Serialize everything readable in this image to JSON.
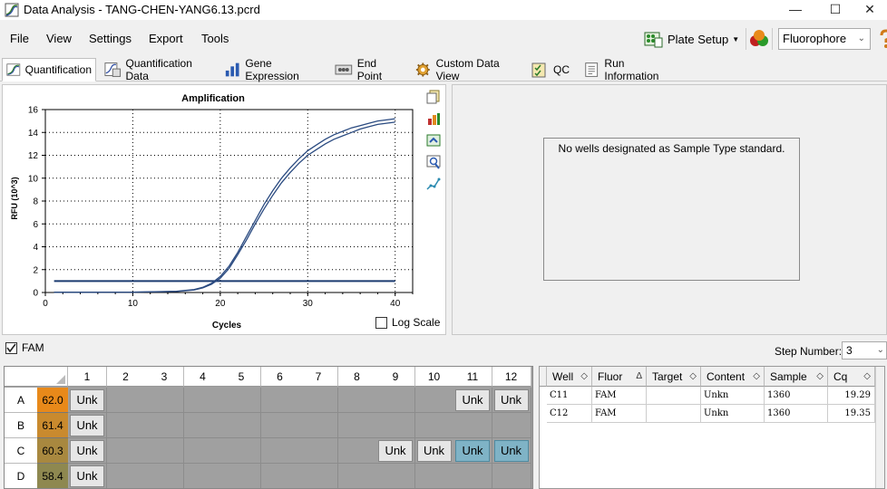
{
  "window": {
    "title": "Data Analysis - TANG-CHEN-YANG6.13.pcrd"
  },
  "menu": [
    "File",
    "View",
    "Settings",
    "Export",
    "Tools"
  ],
  "toolbar": {
    "plate_setup": "Plate Setup",
    "fluorophore": "Fluorophore"
  },
  "tabs": [
    {
      "label": "Quantification",
      "active": true
    },
    {
      "label": "Quantification Data"
    },
    {
      "label": "Gene Expression"
    },
    {
      "label": "End Point"
    },
    {
      "label": "Custom Data View"
    },
    {
      "label": "QC"
    },
    {
      "label": "Run Information"
    }
  ],
  "chart_data": {
    "type": "line",
    "title": "Amplification",
    "xlabel": "Cycles",
    "ylabel": "RFU (10^3)",
    "xlim": [
      0,
      42
    ],
    "ylim": [
      0,
      16
    ],
    "xticks": [
      0,
      10,
      20,
      30,
      40
    ],
    "yticks": [
      0,
      2,
      4,
      6,
      8,
      10,
      12,
      14,
      16
    ],
    "grid": true,
    "threshold": 1.0,
    "threshold_x": [
      1,
      40
    ],
    "series": [
      {
        "well": "C11",
        "x": [
          1,
          5,
          10,
          15,
          17,
          18,
          19,
          20,
          21,
          22,
          23,
          24,
          25,
          26,
          27,
          28,
          29,
          30,
          31,
          32,
          33,
          34,
          35,
          36,
          37,
          38,
          39,
          40
        ],
        "y": [
          0.02,
          0.02,
          0.03,
          0.1,
          0.25,
          0.45,
          0.8,
          1.4,
          2.3,
          3.5,
          4.9,
          6.3,
          7.7,
          8.9,
          10.0,
          10.9,
          11.7,
          12.4,
          12.9,
          13.4,
          13.8,
          14.1,
          14.4,
          14.6,
          14.8,
          15.0,
          15.1,
          15.2
        ]
      },
      {
        "well": "C12",
        "x": [
          1,
          5,
          10,
          15,
          17,
          18,
          19,
          20,
          21,
          22,
          23,
          24,
          25,
          26,
          27,
          28,
          29,
          30,
          31,
          32,
          33,
          34,
          35,
          36,
          37,
          38,
          39,
          40
        ],
        "y": [
          0.02,
          0.02,
          0.03,
          0.09,
          0.22,
          0.4,
          0.72,
          1.25,
          2.1,
          3.3,
          4.6,
          6.0,
          7.3,
          8.5,
          9.6,
          10.5,
          11.3,
          12.0,
          12.5,
          13.0,
          13.4,
          13.7,
          14.0,
          14.3,
          14.5,
          14.7,
          14.8,
          14.9
        ]
      }
    ]
  },
  "chart_ui": {
    "log_scale_label": "Log Scale"
  },
  "std_box": {
    "message": "No wells designated as Sample Type standard."
  },
  "fam": {
    "label": "FAM",
    "step_label": "Step Number:",
    "step_value": "3"
  },
  "plate": {
    "columns": [
      "1",
      "2",
      "3",
      "4",
      "5",
      "6",
      "7",
      "8",
      "9",
      "10",
      "11",
      "12"
    ],
    "rows": [
      {
        "label": "A",
        "temp": "62.0",
        "temp_color": "#e8891a",
        "unk_cols": [
          1,
          11,
          12
        ],
        "sel_cols": []
      },
      {
        "label": "B",
        "temp": "61.4",
        "temp_color": "#c98a2e",
        "unk_cols": [
          1
        ],
        "sel_cols": []
      },
      {
        "label": "C",
        "temp": "60.3",
        "temp_color": "#a8883f",
        "unk_cols": [
          1,
          9,
          10,
          11,
          12
        ],
        "sel_cols": [
          11,
          12
        ]
      },
      {
        "label": "D",
        "temp": "58.4",
        "temp_color": "#8e8850",
        "unk_cols": [
          1
        ],
        "sel_cols": []
      }
    ],
    "unk_label": "Unk"
  },
  "well_table": {
    "headers": [
      "Well",
      "Fluor",
      "Target",
      "Content",
      "Sample",
      "Cq"
    ],
    "rows": [
      [
        "C11",
        "FAM",
        "",
        "Unkn",
        "1360",
        "19.29"
      ],
      [
        "C12",
        "FAM",
        "",
        "Unkn",
        "1360",
        "19.35"
      ]
    ]
  }
}
